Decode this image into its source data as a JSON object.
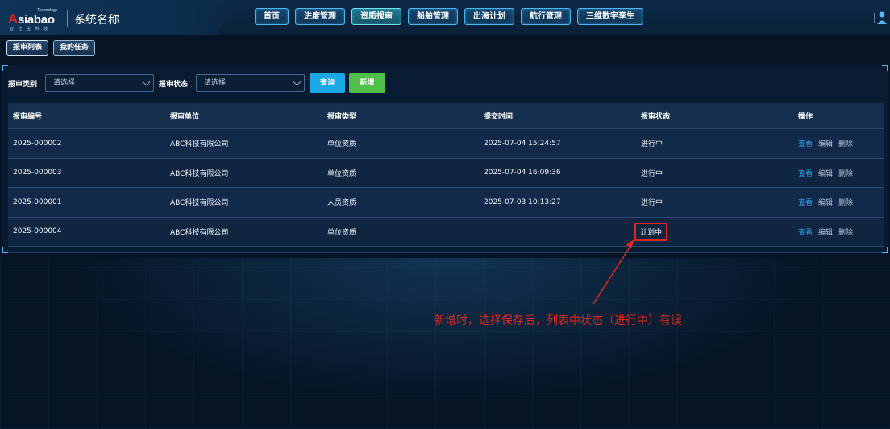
{
  "header": {
    "logo_text": "Asiabao",
    "logo_tagline": "Technology",
    "logo_sub": "亚 士 宝 科 技",
    "system_name": "系统名称",
    "nav": [
      {
        "label": "首页",
        "active": false
      },
      {
        "label": "进度管理",
        "active": false
      },
      {
        "label": "资质报审",
        "active": true
      },
      {
        "label": "船舶管理",
        "active": false
      },
      {
        "label": "出海计划",
        "active": false
      },
      {
        "label": "航行管理",
        "active": false
      },
      {
        "label": "三维数字孪生",
        "active": false
      }
    ],
    "user_icon": "user-icon"
  },
  "subtabs": [
    {
      "label": "报审列表",
      "active": true
    },
    {
      "label": "我的任务",
      "active": false
    }
  ],
  "filters": {
    "type_label": "报审类别",
    "type_placeholder": "请选择",
    "status_label": "报审状态",
    "status_placeholder": "请选择",
    "query_label": "查询",
    "add_label": "新增"
  },
  "table": {
    "columns": [
      "报审编号",
      "报审单位",
      "报审类型",
      "提交时间",
      "报审状态",
      "操作"
    ],
    "rows": [
      {
        "id": "2025-000002",
        "unit": "ABC科技有限公司",
        "type": "单位资质",
        "time": "2025-07-04 15:24:57",
        "status": "进行中"
      },
      {
        "id": "2025-000003",
        "unit": "ABC科技有限公司",
        "type": "单位资质",
        "time": "2025-07-04 16:09:36",
        "status": "进行中"
      },
      {
        "id": "2025-000001",
        "unit": "ABC科技有限公司",
        "type": "人员资质",
        "time": "2025-07-03 10:13:27",
        "status": "进行中"
      },
      {
        "id": "2025-000004",
        "unit": "ABC科技有限公司",
        "type": "单位资质",
        "time": "",
        "status": "计划中"
      }
    ],
    "actions": {
      "view": "查看",
      "edit": "编辑",
      "delete": "删除"
    }
  },
  "annotation": {
    "text": "新增时，选择保存后，列表中状态（进行中）有误",
    "color": "#e0281f"
  },
  "colors": {
    "accent": "#1aa7e6",
    "add": "#4fbf49",
    "background": "#061425"
  }
}
